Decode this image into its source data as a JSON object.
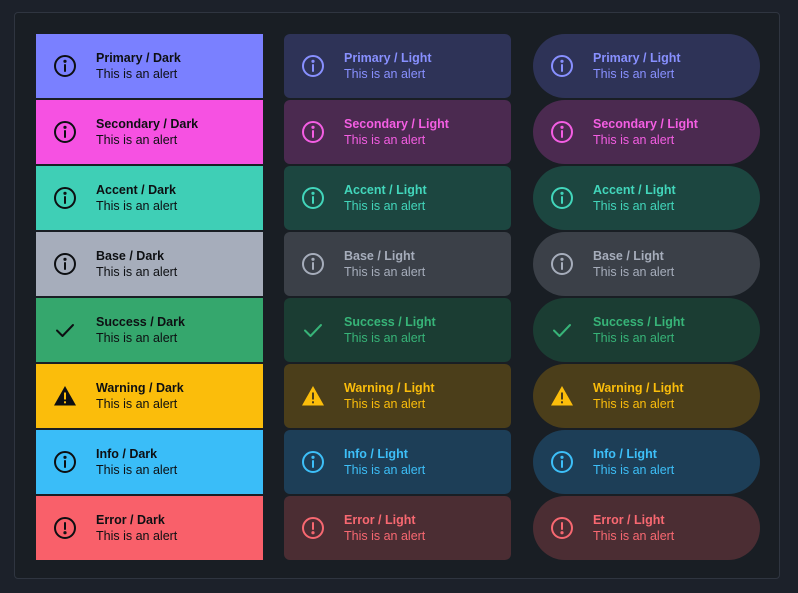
{
  "variants": [
    {
      "key": "primary",
      "icon": "info",
      "dark_title": "Primary / Dark",
      "light_title": "Primary / Light",
      "message": "This is an alert",
      "solid": "#7a80ff",
      "tint": "#2e3357",
      "fg": "#8890ff"
    },
    {
      "key": "secondary",
      "icon": "info",
      "dark_title": "Secondary / Dark",
      "light_title": "Secondary / Light",
      "message": "This is an alert",
      "solid": "#f651e2",
      "tint": "#4b2a50",
      "fg": "#f45ee3"
    },
    {
      "key": "accent",
      "icon": "info",
      "dark_title": "Accent / Dark",
      "light_title": "Accent / Light",
      "message": "This is an alert",
      "solid": "#3fcfb6",
      "tint": "#1c4640",
      "fg": "#42d6bb"
    },
    {
      "key": "base",
      "icon": "info",
      "dark_title": "Base / Dark",
      "light_title": "Base / Light",
      "message": "This is an alert",
      "solid": "#a6adbb",
      "tint": "#3b4048",
      "fg": "#a6adbb"
    },
    {
      "key": "success",
      "icon": "check",
      "dark_title": "Success / Dark",
      "light_title": "Success / Light",
      "message": "This is an alert",
      "solid": "#35a76d",
      "tint": "#1b3d33",
      "fg": "#37b478"
    },
    {
      "key": "warning",
      "icon": "warning",
      "dark_title": "Warning / Dark",
      "light_title": "Warning / Light",
      "message": "This is an alert",
      "solid": "#fbbd0b",
      "tint": "#4b3e1a",
      "fg": "#fbbd0b"
    },
    {
      "key": "info",
      "icon": "info",
      "dark_title": "Info / Dark",
      "light_title": "Info / Light",
      "message": "This is an alert",
      "solid": "#3abdf8",
      "tint": "#1d3e57",
      "fg": "#3dbff8"
    },
    {
      "key": "error",
      "icon": "error",
      "dark_title": "Error / Dark",
      "light_title": "Error / Light",
      "message": "This is an alert",
      "solid": "#f9606a",
      "tint": "#4b2d33",
      "fg": "#f86871"
    }
  ]
}
